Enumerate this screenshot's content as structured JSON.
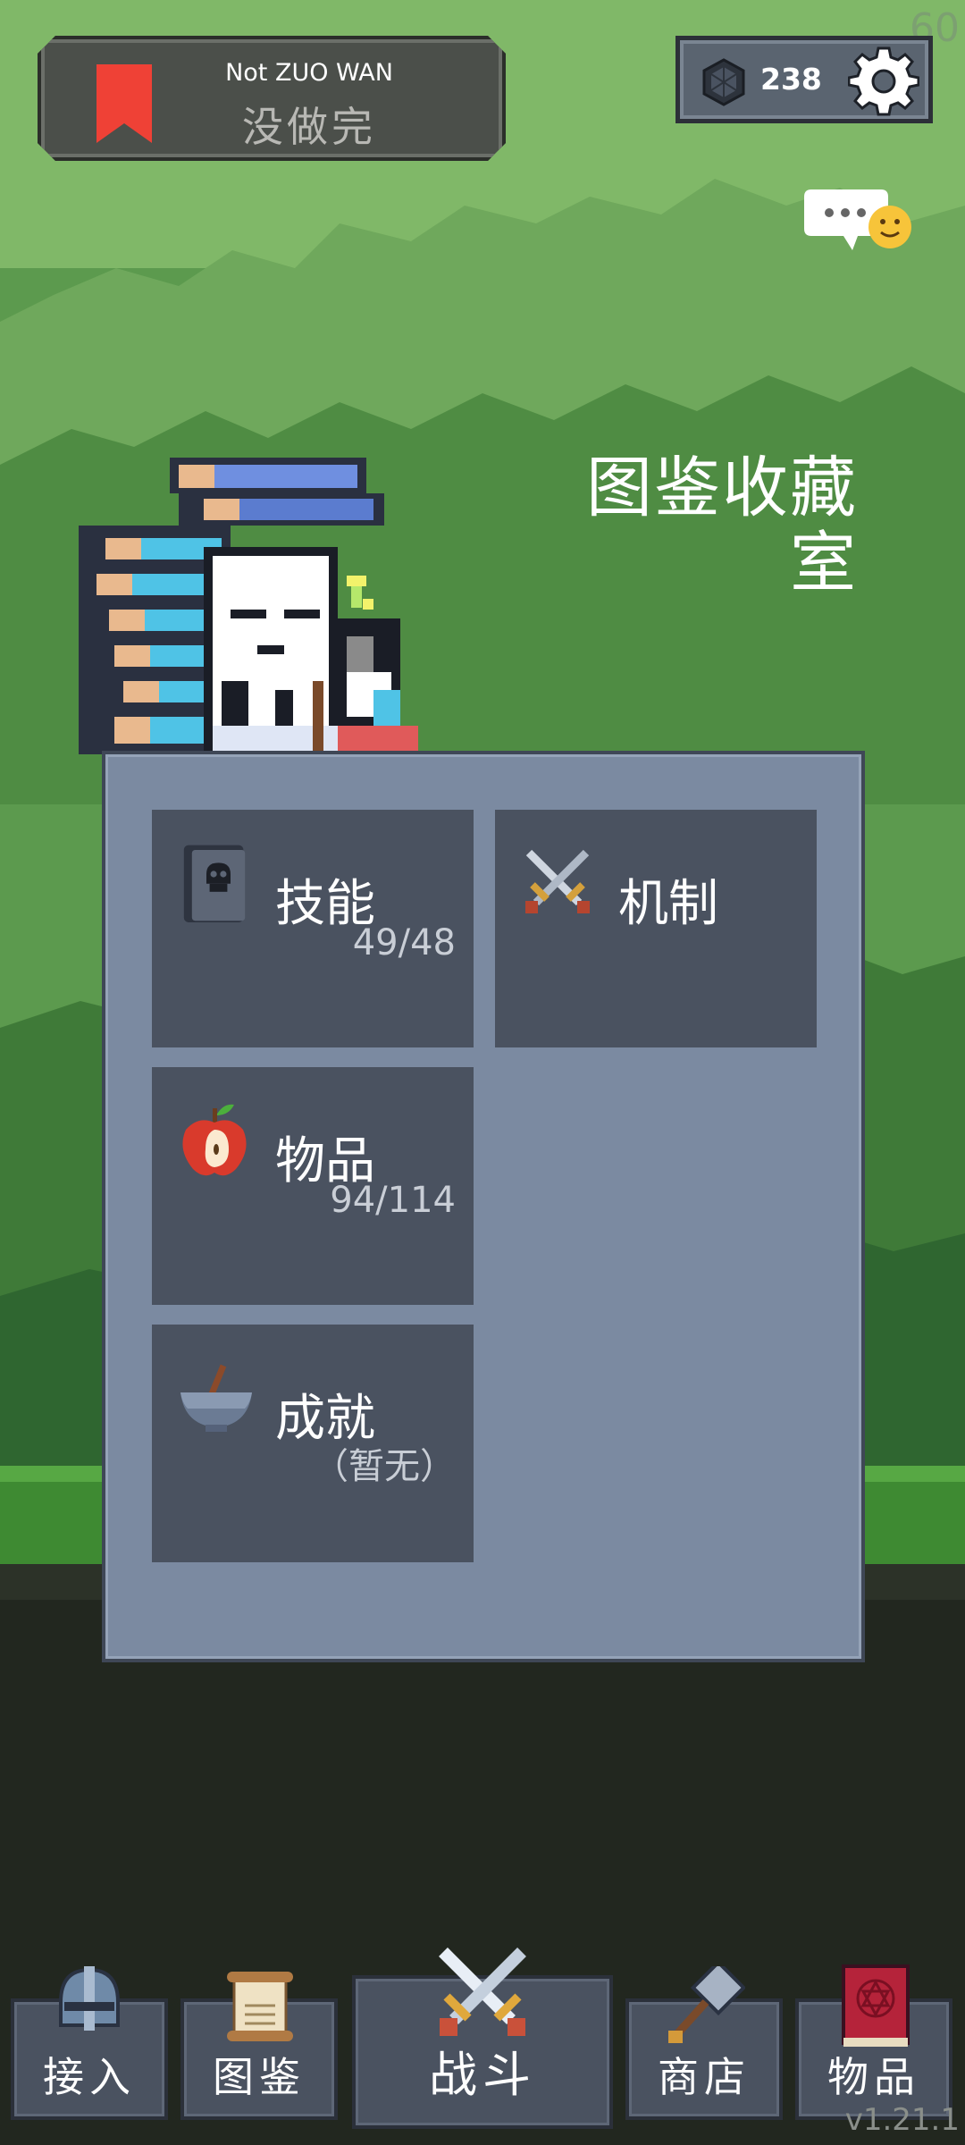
{
  "status": {
    "fps": "60",
    "version": "v1.21.1"
  },
  "title_panel": {
    "english": "Not ZUO WAN",
    "chinese": "没做完",
    "icon": "bookmark-icon",
    "color": "#ef4136"
  },
  "currency": {
    "gems": "238",
    "icon": "gem-icon"
  },
  "settings": {
    "icon": "gear-icon"
  },
  "chat": {
    "icon": "chat-bubble-icon"
  },
  "room_title": {
    "line1": "图鉴收藏",
    "line2": "室"
  },
  "cards": [
    {
      "label": "技能",
      "count": "49/48",
      "icon": "skull-book-icon"
    },
    {
      "label": "机制",
      "count": "",
      "icon": "crossed-swords-icon"
    },
    {
      "label": "物品",
      "count": "94/114",
      "icon": "apple-icon"
    },
    {
      "label": "成就",
      "count": "（暂无）",
      "icon": "bowl-icon"
    }
  ],
  "nav": [
    {
      "label": "接入",
      "icon": "helmet-icon"
    },
    {
      "label": "图鉴",
      "icon": "scroll-icon"
    },
    {
      "label": "战斗",
      "icon": "crossed-swords-icon"
    },
    {
      "label": "商店",
      "icon": "hammer-icon"
    },
    {
      "label": "物品",
      "icon": "spellbook-icon"
    }
  ],
  "colors": {
    "panel": "#7b8aa1",
    "card": "#4a5260",
    "accent_red": "#ef4136"
  }
}
